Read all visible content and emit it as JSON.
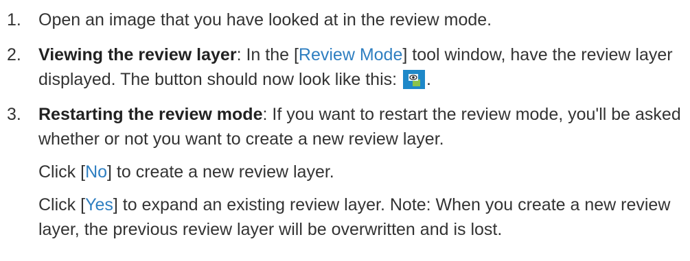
{
  "steps": [
    {
      "num": "1.",
      "text": "Open an image that you have looked at in the review mode."
    },
    {
      "num": "2.",
      "title": "Viewing the review layer",
      "t1": ": In the [",
      "link": "Review Mode",
      "t2": "] tool window, have the review layer displayed. The button should now look like this: ",
      "t3": ".",
      "icon": "review-layer-eye-icon"
    },
    {
      "num": "3.",
      "title": "Restarting the review mode",
      "text": ": If you want to restart the review mode, you'll be asked whether or not you want to create a new review layer.",
      "no": {
        "pre": "Click [",
        "link": "No",
        "post": "] to create a new review layer."
      },
      "yes": {
        "pre": "Click [",
        "link": "Yes",
        "post": "] to expand an existing review layer. Note: When you create a new review layer, the previous review layer will be overwritten and is lost."
      }
    }
  ],
  "colors": {
    "text": "#333333",
    "link": "#2f7fc1",
    "icon_bg": "#1e88c8",
    "icon_accent": "#8bc34a"
  }
}
